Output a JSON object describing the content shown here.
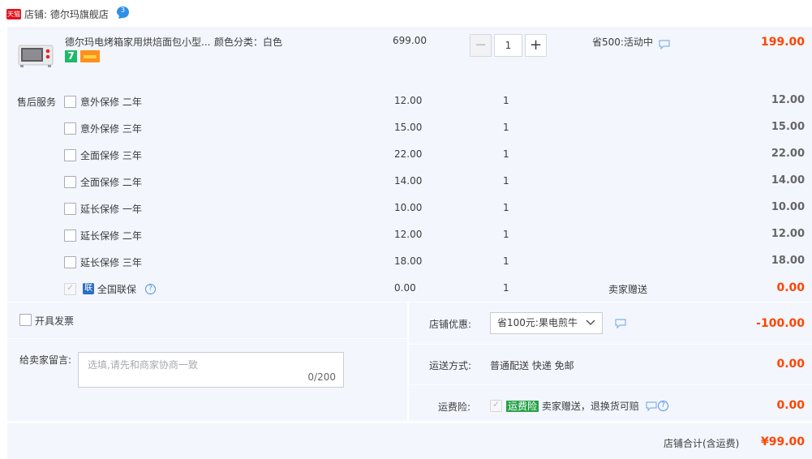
{
  "shop": {
    "label": "店铺:",
    "name": "德尔玛旗舰店",
    "platform_badge": "天猫",
    "chat_badge": "3"
  },
  "product": {
    "title": "德尔玛电烤箱家用烘焙面包小型...",
    "sku": "颜色分类：白色",
    "price": "699.00",
    "quantity": "1",
    "promo": "省500:活动中",
    "subtotal": "199.00",
    "badge_7": "7"
  },
  "services": {
    "label": "售后服务",
    "items": [
      {
        "name": "意外保修 二年",
        "price": "12.00",
        "qty": "1",
        "note": "",
        "subtotal": "12.00",
        "checked": false
      },
      {
        "name": "意外保修 三年",
        "price": "15.00",
        "qty": "1",
        "note": "",
        "subtotal": "15.00",
        "checked": false
      },
      {
        "name": "全面保修 三年",
        "price": "22.00",
        "qty": "1",
        "note": "",
        "subtotal": "22.00",
        "checked": false
      },
      {
        "name": "全面保修 二年",
        "price": "14.00",
        "qty": "1",
        "note": "",
        "subtotal": "14.00",
        "checked": false
      },
      {
        "name": "延长保修 一年",
        "price": "10.00",
        "qty": "1",
        "note": "",
        "subtotal": "10.00",
        "checked": false
      },
      {
        "name": "延长保修 二年",
        "price": "12.00",
        "qty": "1",
        "note": "",
        "subtotal": "12.00",
        "checked": false
      },
      {
        "name": "延长保修 三年",
        "price": "18.00",
        "qty": "1",
        "note": "",
        "subtotal": "18.00",
        "checked": false
      },
      {
        "name": "全国联保",
        "price": "0.00",
        "qty": "1",
        "note": "卖家赠送",
        "subtotal": "0.00",
        "checked": true,
        "badge": "联"
      }
    ]
  },
  "invoice": {
    "label": "开具发票"
  },
  "message": {
    "label": "给卖家留言:",
    "placeholder": "选填,请先和商家协商一致",
    "counter": "0/200"
  },
  "discount": {
    "label": "店铺优惠:",
    "selected": "省100元:果电煎牛",
    "amount": "-100.00"
  },
  "shipping": {
    "label": "运送方式:",
    "method": "普通配送 快递 免邮",
    "amount": "0.00"
  },
  "insurance": {
    "label": "运费险:",
    "badge": "运费险",
    "desc": "卖家赠送，退换货可赔",
    "amount": "0.00"
  },
  "total": {
    "label": "店铺合计(含运费)",
    "amount": "¥99.00"
  },
  "colors": {
    "accent_red": "#ff4400",
    "panel_bg": "#f3f6fd",
    "insurance_green": "#26a148",
    "link_blue": "#4e91e8"
  }
}
